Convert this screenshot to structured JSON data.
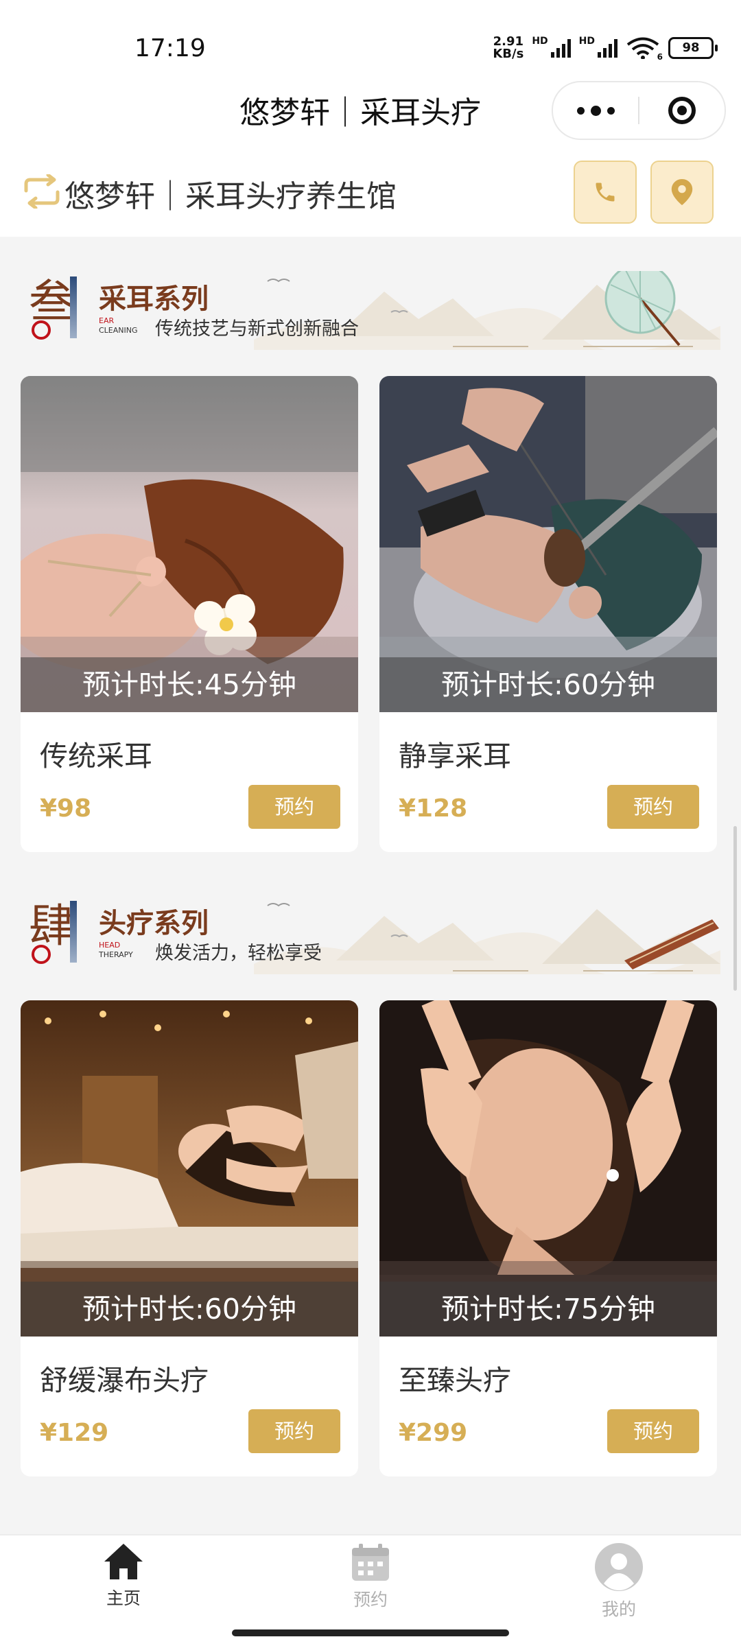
{
  "status_bar": {
    "time": "17:19",
    "net_speed_value": "2.91",
    "net_speed_unit": "KB/s",
    "hd1": "HD",
    "hd2": "HD",
    "wifi_sub": "6",
    "battery": "98"
  },
  "header": {
    "title": "悠梦轩｜采耳头疗"
  },
  "store": {
    "name": "悠梦轩｜采耳头疗养生馆"
  },
  "sections": [
    {
      "char": "叁",
      "title": "采耳系列",
      "en_1": "EAR",
      "en_2": "CLEANING",
      "subtitle": "传统技艺与新式创新融合",
      "items": [
        {
          "duration": "预计时长:45分钟",
          "name": "传统采耳",
          "price": "¥98",
          "button": "预约"
        },
        {
          "duration": "预计时长:60分钟",
          "name": "静享采耳",
          "price": "¥128",
          "button": "预约"
        }
      ]
    },
    {
      "char": "肆",
      "title": "头疗系列",
      "en_1": "HEAD",
      "en_2": "THERAPY",
      "subtitle": "焕发活力，轻松享受",
      "items": [
        {
          "duration": "预计时长:60分钟",
          "name": "舒缓瀑布头疗",
          "price": "¥129",
          "button": "预约"
        },
        {
          "duration": "预计时长:75分钟",
          "name": "至臻头疗",
          "price": "¥299",
          "button": "预约"
        }
      ]
    }
  ],
  "tabbar": {
    "home": "主页",
    "booking": "预约",
    "mine": "我的"
  },
  "colors": {
    "accent": "#d6ae55",
    "banner_title": "#7a3b1d",
    "seal_red": "#c0121a"
  }
}
